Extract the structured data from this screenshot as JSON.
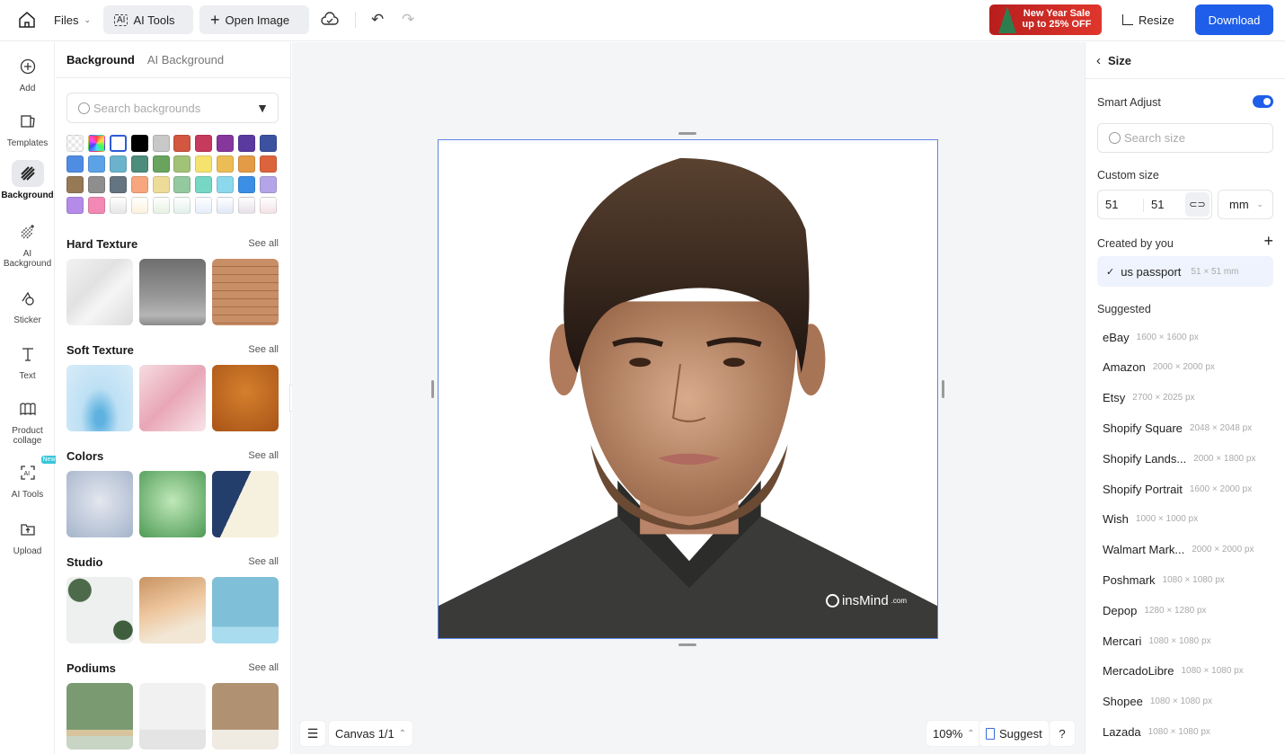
{
  "topbar": {
    "files_label": "Files",
    "ai_tools_label": "AI Tools",
    "open_image_label": "Open Image",
    "promo_line1": "New Year Sale",
    "promo_line2": "up to 25% OFF",
    "resize_label": "Resize",
    "download_label": "Download"
  },
  "leftnav": {
    "items": [
      {
        "label": "Add",
        "icon": "plus-circle-icon"
      },
      {
        "label": "Templates",
        "icon": "templates-icon"
      },
      {
        "label": "Background",
        "icon": "background-hatch-icon",
        "active": true
      },
      {
        "label": "AI Background",
        "icon": "ai-background-icon"
      },
      {
        "label": "Sticker",
        "icon": "sticker-icon"
      },
      {
        "label": "Text",
        "icon": "text-icon"
      },
      {
        "label": "Product collage",
        "icon": "collage-icon"
      },
      {
        "label": "AI Tools",
        "icon": "ai-tools-icon",
        "badge": "New"
      },
      {
        "label": "Upload",
        "icon": "upload-icon"
      }
    ]
  },
  "bgpanel": {
    "tabs": [
      "Background",
      "AI Background"
    ],
    "search_placeholder": "Search backgrounds",
    "swatch_colors": [
      "transparent",
      "rainbow",
      "#ffffff",
      "#000000",
      "#c8c8c8",
      "#d25640",
      "#c63a5e",
      "#86379c",
      "#5b3aa0",
      "#3c51a0",
      "#4f8de3",
      "#5ba2e6",
      "#6bb3cc",
      "#4e8c7c",
      "#6aa35d",
      "#a2c275",
      "#f5e36e",
      "#edbd55",
      "#e49b45",
      "#dc643c",
      "#967955",
      "#8e8e8e",
      "#647480",
      "#f7a67d",
      "#eddc98",
      "#93c99f",
      "#76d7c4",
      "#8cd8ec",
      "#3b8fe5",
      "#b4a5e8",
      "#b48be8",
      "#f288b3",
      "#e6e6e6",
      "#fbf2dc",
      "#e6f2e2",
      "#e2f0ea",
      "#e4eefb",
      "#e0e8f7",
      "#e8e0e8",
      "#f3e2e6"
    ],
    "selected_swatch": 2,
    "sections": [
      {
        "title": "Hard Texture",
        "see_all": "See all",
        "thumbs": [
          "marble",
          "concrete",
          "wood"
        ]
      },
      {
        "title": "Soft Texture",
        "see_all": "See all",
        "thumbs": [
          "water-splash",
          "pink-silk",
          "leather"
        ]
      },
      {
        "title": "Colors",
        "see_all": "See all",
        "thumbs": [
          "blue-gray-gradient",
          "green-gradient",
          "navy-cream"
        ]
      },
      {
        "title": "Studio",
        "see_all": "See all",
        "thumbs": [
          "plants-white",
          "beige-drape",
          "blue-wall"
        ]
      },
      {
        "title": "Podiums",
        "see_all": "See all",
        "thumbs": [
          "green-podium",
          "white-podium",
          "tan-podium"
        ]
      }
    ]
  },
  "canvas": {
    "watermark": "insMind",
    "watermark_suffix": ".com",
    "canvas_label": "Canvas 1/1",
    "zoom": "109%",
    "suggest_label": "Suggest",
    "help_label": "?"
  },
  "rightpanel": {
    "title": "Size",
    "smart_adjust_label": "Smart Adjust",
    "smart_adjust_on": true,
    "search_placeholder": "Search size",
    "custom_size_label": "Custom size",
    "width": "51",
    "height": "51",
    "unit": "mm",
    "created_label": "Created by you",
    "created_items": [
      {
        "name": "us passport",
        "dim": "51 × 51 mm",
        "checked": true
      }
    ],
    "suggested_label": "Suggested",
    "suggested": [
      {
        "name": "eBay",
        "dim": "1600 × 1600 px"
      },
      {
        "name": "Amazon",
        "dim": "2000 × 2000 px"
      },
      {
        "name": "Etsy",
        "dim": "2700 × 2025 px"
      },
      {
        "name": "Shopify Square",
        "dim": "2048 × 2048 px"
      },
      {
        "name": "Shopify Lands...",
        "dim": "2000 × 1800 px"
      },
      {
        "name": "Shopify Portrait",
        "dim": "1600 × 2000 px"
      },
      {
        "name": "Wish",
        "dim": "1000 × 1000 px"
      },
      {
        "name": "Walmart Mark...",
        "dim": "2000 × 2000 px"
      },
      {
        "name": "Poshmark",
        "dim": "1080 × 1080 px"
      },
      {
        "name": "Depop",
        "dim": "1280 × 1280 px"
      },
      {
        "name": "Mercari",
        "dim": "1080 × 1080 px"
      },
      {
        "name": "MercadoLibre",
        "dim": "1080 × 1080 px"
      },
      {
        "name": "Shopee",
        "dim": "1080 × 1080 px"
      },
      {
        "name": "Lazada",
        "dim": "1080 × 1080 px"
      }
    ]
  }
}
